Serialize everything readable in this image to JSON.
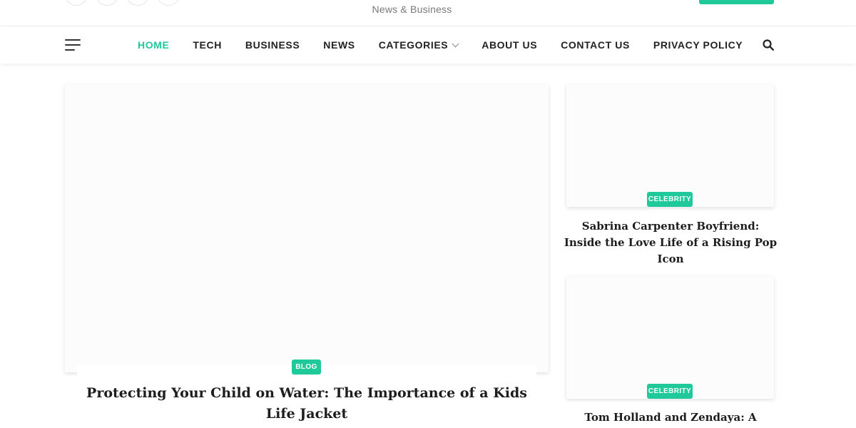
{
  "logo": {
    "tagline": "News & Business"
  },
  "nav": {
    "items": [
      {
        "label": "HOME",
        "active": true
      },
      {
        "label": "TECH"
      },
      {
        "label": "BUSINESS"
      },
      {
        "label": "NEWS"
      },
      {
        "label": "CATEGORIES",
        "has_dropdown": true
      },
      {
        "label": "ABOUT US"
      },
      {
        "label": "CONTACT US"
      },
      {
        "label": "PRIVACY POLICY"
      }
    ]
  },
  "featured": {
    "category": "BLOG",
    "title": "Protecting Your Child on Water: The Importance of a Kids Life Jacket"
  },
  "side_posts": [
    {
      "category": "CELEBRITY",
      "title": "Sabrina Carpenter Boyfriend: Inside the Love Life of a Rising Pop Icon"
    },
    {
      "category": "CELEBRITY",
      "title": "Tom Holland and Zendaya: A Modern-"
    }
  ],
  "colors": {
    "accent": "#1fc99a",
    "text": "#222222"
  },
  "icons": {
    "menu": "hamburger-icon",
    "search": "search-icon",
    "dropdown": "chevron-down-icon"
  }
}
